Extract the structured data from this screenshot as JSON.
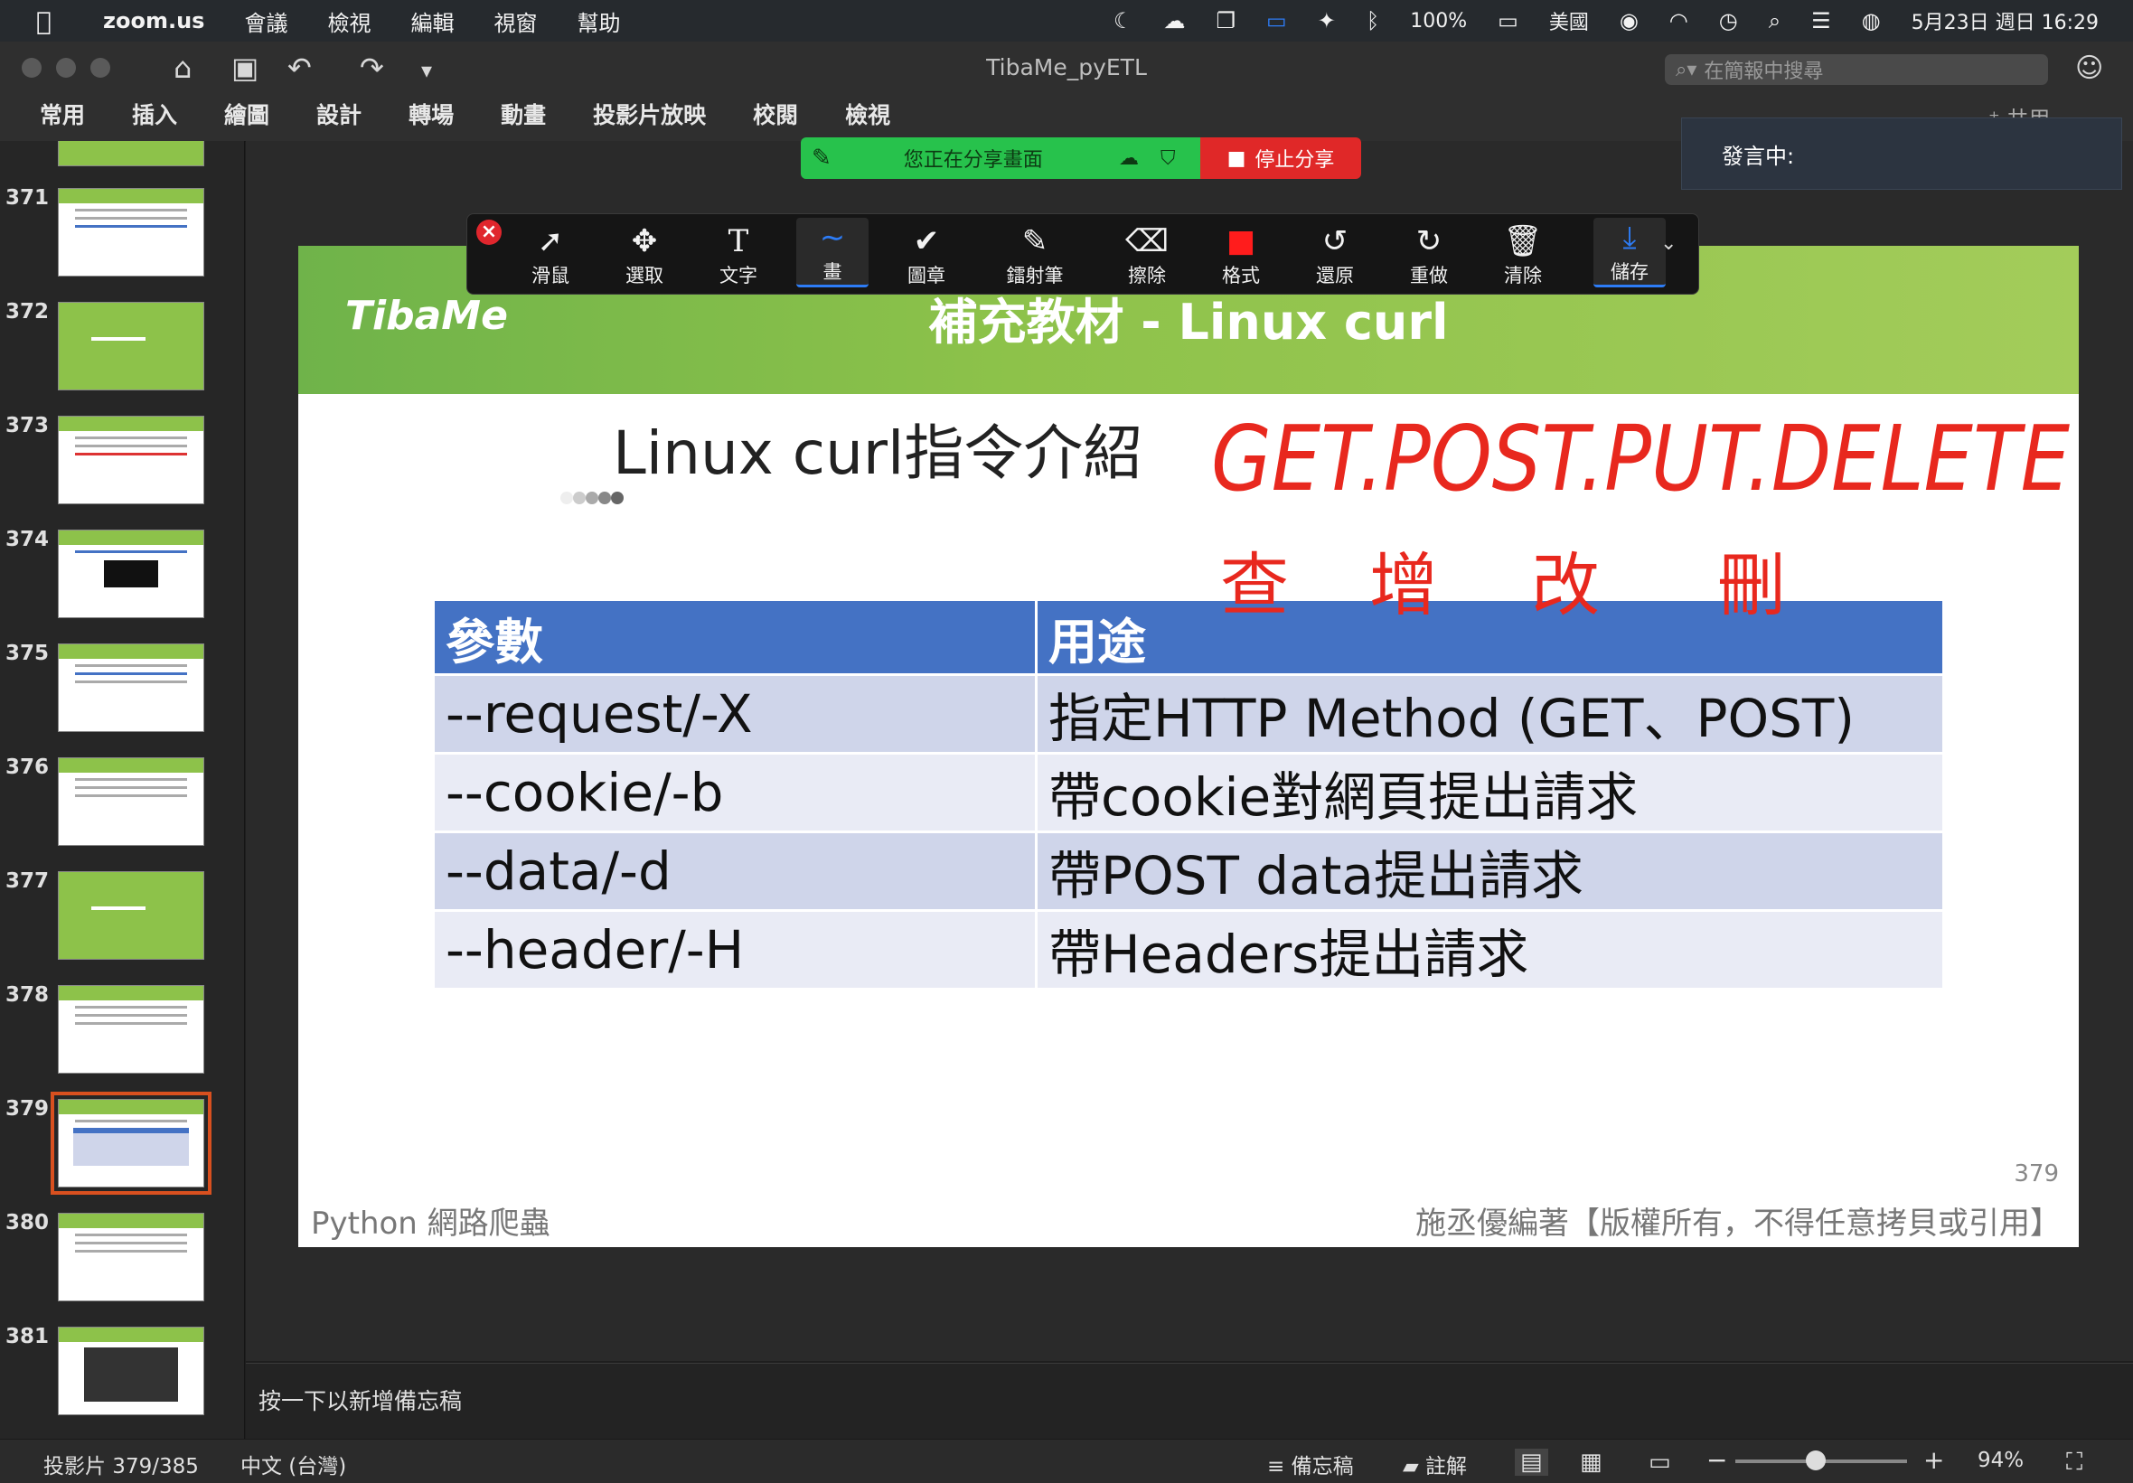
{
  "menubar": {
    "app": "zoom.us",
    "items": [
      "會議",
      "檢視",
      "編輯",
      "視窗",
      "幫助"
    ],
    "battery": "100%",
    "input_source": "美國",
    "datetime": "5月23日 週日 16:29"
  },
  "window": {
    "doc_title": "TibaMe_pyETL",
    "search_placeholder": "在簡報中搜尋",
    "ribbon_tabs": [
      "常用",
      "插入",
      "繪圖",
      "設計",
      "轉場",
      "動畫",
      "投影片放映",
      "校閱",
      "檢視"
    ],
    "share_label": "共用"
  },
  "zoom_share": {
    "status": "您正在分享畫面",
    "stop": "停止分享",
    "speaker": "發言中:"
  },
  "annotation_tools": [
    {
      "label": "滑鼠",
      "icon": "pointer-icon",
      "glyph": "➚"
    },
    {
      "label": "選取",
      "icon": "move-icon",
      "glyph": "✥"
    },
    {
      "label": "文字",
      "icon": "text-icon",
      "glyph": "T"
    },
    {
      "label": "畫",
      "icon": "draw-icon",
      "glyph": "∼"
    },
    {
      "label": "圖章",
      "icon": "stamp-icon",
      "glyph": "✔"
    },
    {
      "label": "鐳射筆",
      "icon": "laser-icon",
      "glyph": "✎"
    },
    {
      "label": "擦除",
      "icon": "eraser-icon",
      "glyph": "⌫"
    },
    {
      "label": "格式",
      "icon": "format-color-icon",
      "glyph": "■"
    },
    {
      "label": "還原",
      "icon": "undo-icon",
      "glyph": "↺"
    },
    {
      "label": "重做",
      "icon": "redo-icon",
      "glyph": "↻"
    },
    {
      "label": "清除",
      "icon": "trash-icon",
      "glyph": "🗑"
    },
    {
      "label": "儲存",
      "icon": "save-icon",
      "glyph": "⤓"
    }
  ],
  "thumbnails": [
    "371",
    "372",
    "373",
    "374",
    "375",
    "376",
    "377",
    "378",
    "379",
    "380",
    "381"
  ],
  "slide": {
    "logo": "TibaMe",
    "title": "補充教材 - Linux curl",
    "subtitle": "Linux curl指令介紹",
    "table": {
      "headers": [
        "參數",
        "用途"
      ],
      "rows": [
        [
          "--request/-X",
          "指定HTTP Method (GET、POST)"
        ],
        [
          "--cookie/-b",
          "帶cookie對網頁提出請求"
        ],
        [
          "--data/-d",
          "帶POST data提出請求"
        ],
        [
          "--header/-H",
          "帶Headers提出請求"
        ]
      ]
    },
    "handwriting_line1": "GET.POST.PUT.DELETE",
    "handwriting_line2": [
      "查",
      "增",
      "改",
      "刪"
    ],
    "number": "379",
    "footer_left": "Python 網路爬蟲",
    "footer_right": "施丞優編著【版權所有，不得任意拷貝或引用】"
  },
  "notes_placeholder": "按一下以新增備忘稿",
  "statusbar": {
    "slide_counter": "投影片 379/385",
    "language": "中文 (台灣)",
    "notes": "備忘稿",
    "comments": "註解",
    "zoom": "94%"
  },
  "colors": {
    "header_green": "#8dc24a",
    "table_header": "#4472c4",
    "ink_red": "#e8281e",
    "selection_orange": "#d9501f"
  }
}
